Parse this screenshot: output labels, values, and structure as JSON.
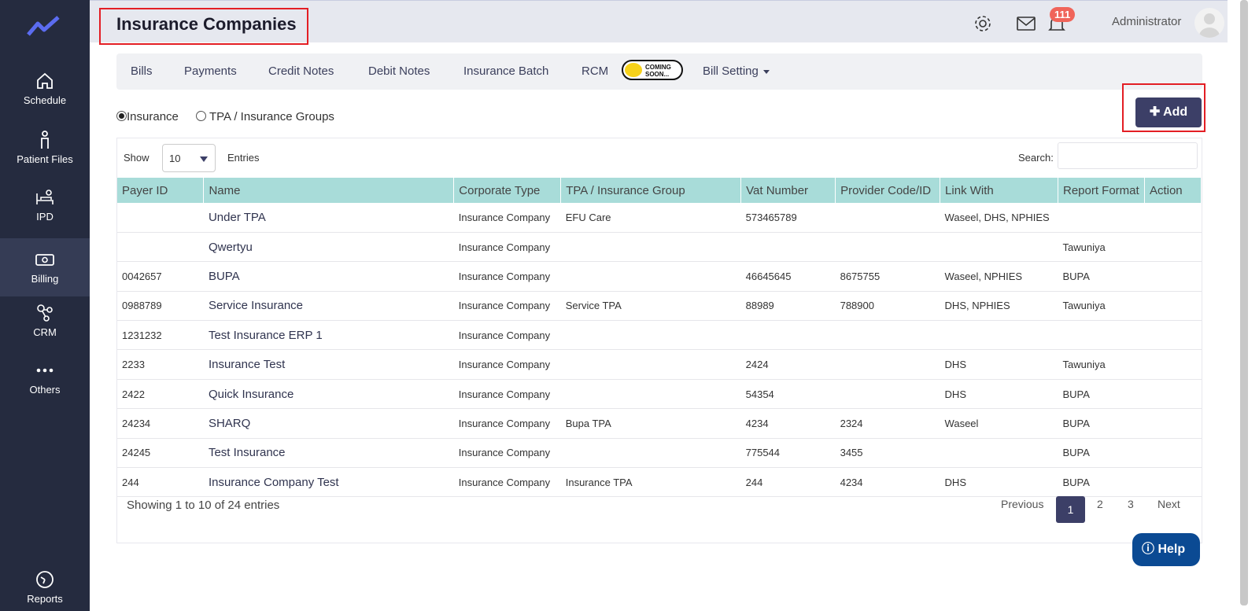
{
  "sidebar": {
    "items": [
      {
        "label": "Schedule",
        "icon": "home-icon"
      },
      {
        "label": "Patient Files",
        "icon": "person-icon"
      },
      {
        "label": "IPD",
        "icon": "bed-icon"
      },
      {
        "label": "Billing",
        "icon": "money-icon"
      },
      {
        "label": "CRM",
        "icon": "network-icon"
      },
      {
        "label": "Others",
        "icon": "more-icon"
      },
      {
        "label": "Reports",
        "icon": "chart-icon"
      }
    ]
  },
  "header": {
    "title": "Insurance Companies",
    "notification_count": "111",
    "user_name": "Administrator"
  },
  "tabs": {
    "bills": "Bills",
    "payments": "Payments",
    "credit_notes": "Credit Notes",
    "debit_notes": "Debit Notes",
    "insurance_batch": "Insurance Batch",
    "rcm": "RCM",
    "coming_soon_line1": "COMING",
    "coming_soon_line2": "SOON...",
    "bill_setting": "Bill Setting"
  },
  "filters": {
    "insurance": "Insurance",
    "tpa_groups": "TPA / Insurance Groups"
  },
  "add_button": "Add",
  "list_controls": {
    "show": "Show",
    "page_size": "10",
    "entries": "Entries",
    "search_label": "Search:"
  },
  "table": {
    "columns": [
      "Payer ID",
      "Name",
      "Corporate Type",
      "TPA / Insurance Group",
      "Vat Number",
      "Provider Code/ID",
      "Link With",
      "Report Format",
      "Action"
    ],
    "rows": [
      {
        "payer_id": "",
        "name": "Under TPA",
        "type": "Insurance Company",
        "tpa": "EFU Care",
        "vat": "573465789",
        "provider": "",
        "link": "Waseel, DHS, NPHIES",
        "report": ""
      },
      {
        "payer_id": "",
        "name": "Qwertyu",
        "type": "Insurance Company",
        "tpa": "",
        "vat": "",
        "provider": "",
        "link": "",
        "report": "Tawuniya"
      },
      {
        "payer_id": "0042657",
        "name": "BUPA",
        "type": "Insurance Company",
        "tpa": "",
        "vat": "46645645",
        "provider": "8675755",
        "link": "Waseel, NPHIES",
        "report": "BUPA"
      },
      {
        "payer_id": "0988789",
        "name": "Service Insurance",
        "type": "Insurance Company",
        "tpa": "Service TPA",
        "vat": "88989",
        "provider": "788900",
        "link": "DHS, NPHIES",
        "report": "Tawuniya"
      },
      {
        "payer_id": "1231232",
        "name": "Test Insurance ERP 1",
        "type": "Insurance Company",
        "tpa": "",
        "vat": "",
        "provider": "",
        "link": "",
        "report": ""
      },
      {
        "payer_id": "2233",
        "name": "Insurance Test",
        "type": "Insurance Company",
        "tpa": "",
        "vat": "2424",
        "provider": "",
        "link": "DHS",
        "report": "Tawuniya"
      },
      {
        "payer_id": "2422",
        "name": "Quick Insurance",
        "type": "Insurance Company",
        "tpa": "",
        "vat": "54354",
        "provider": "",
        "link": "DHS",
        "report": "BUPA"
      },
      {
        "payer_id": "24234",
        "name": "SHARQ",
        "type": "Insurance Company",
        "tpa": "Bupa TPA",
        "vat": "4234",
        "provider": "2324",
        "link": "Waseel",
        "report": "BUPA"
      },
      {
        "payer_id": "24245",
        "name": "Test Insurance",
        "type": "Insurance Company",
        "tpa": "",
        "vat": "775544",
        "provider": "3455",
        "link": "",
        "report": "BUPA"
      },
      {
        "payer_id": "244",
        "name": "Insurance Company Test",
        "type": "Insurance Company",
        "tpa": "Insurance TPA",
        "vat": "244",
        "provider": "4234",
        "link": "DHS",
        "report": "BUPA"
      }
    ]
  },
  "footer": {
    "showing": "Showing 1 to 10 of 24 entries",
    "previous": "Previous",
    "pages": [
      "1",
      "2",
      "3"
    ],
    "next": "Next"
  },
  "help": "Help",
  "colors": {
    "sidebar": "#252b3f",
    "accent": "#3c3f67",
    "table_header": "#a8dcd9",
    "highlight_frame": "#e31e24",
    "help": "#0b4a93"
  }
}
